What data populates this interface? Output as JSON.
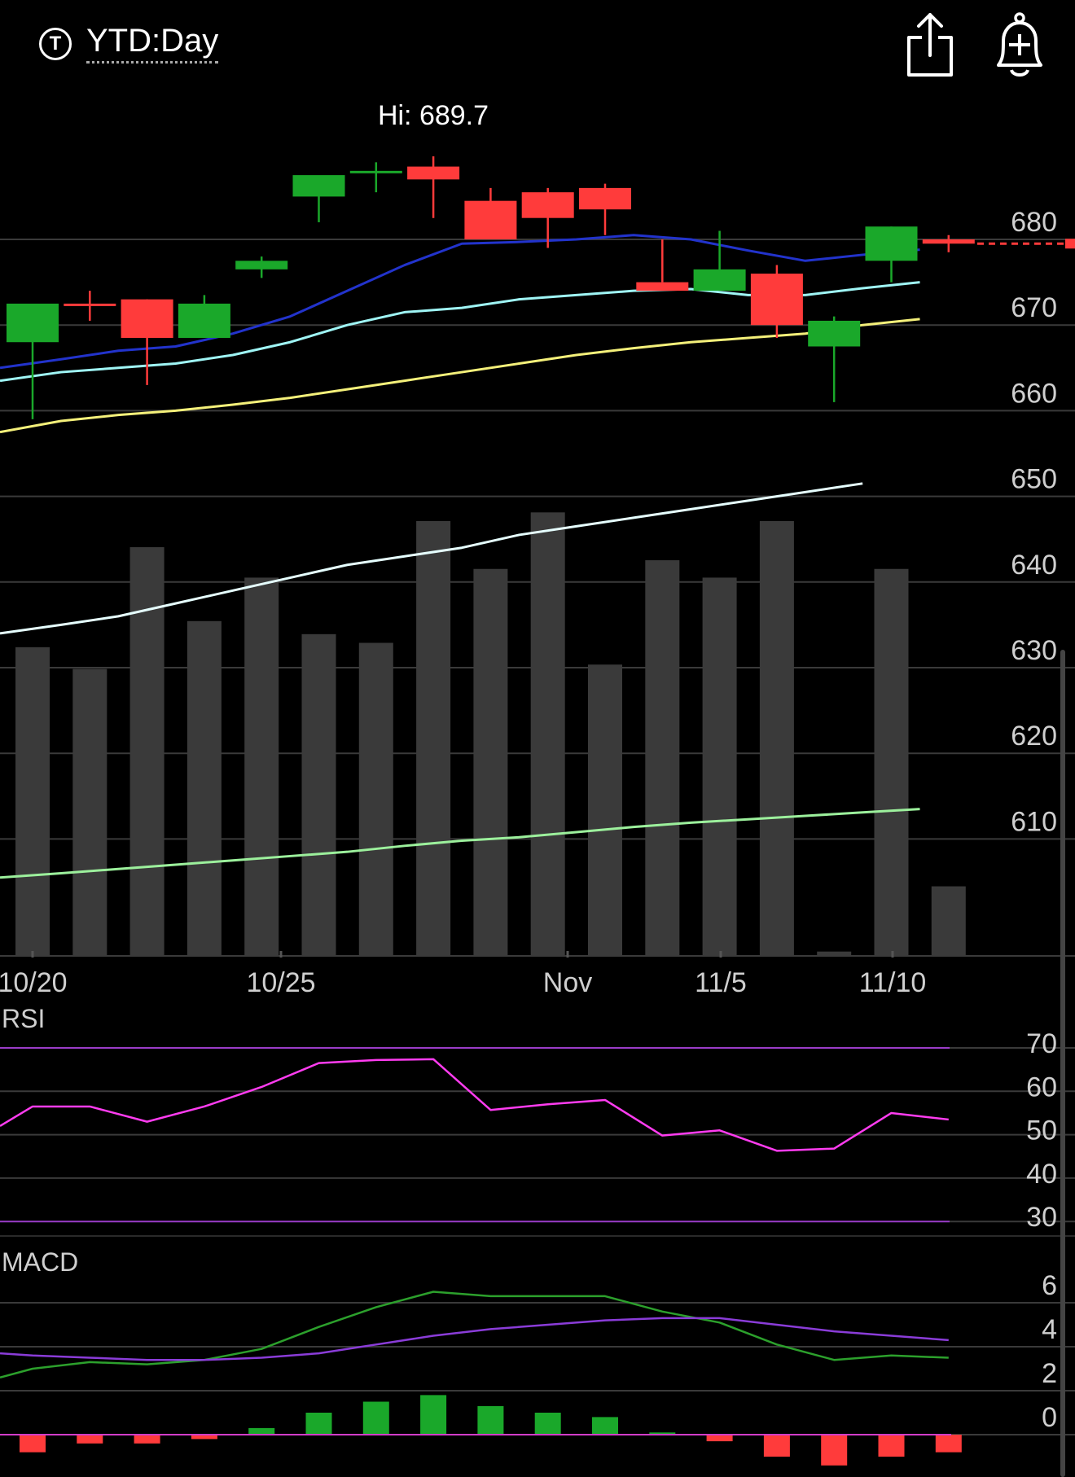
{
  "header": {
    "t_icon_letter": "T",
    "title": "YTD:Day",
    "share_icon": "share-icon",
    "alert_icon": "bell-plus-icon"
  },
  "colors": {
    "up": "#1aa82a",
    "down": "#ff3b3b",
    "ma_blue": "#2233cc",
    "ma_cyan": "#9ff5f5",
    "ma_yellow": "#f4f07a",
    "vol_white": "#e6ffff",
    "vol_green": "#9cf09c",
    "rsi": "#ff3cf0",
    "rsi_bounds": "#9a3cc8",
    "macd": "#2ca02c",
    "signal": "#8a3cd8",
    "hist_up": "#1aa82a",
    "hist_down": "#ff3b3b"
  },
  "chart_data": [
    {
      "type": "candlestick",
      "hi_label": "Hi: 689.7",
      "y_ticks": [
        "680",
        "670",
        "660",
        "650",
        "640",
        "630",
        "620",
        "610"
      ],
      "x_labels": [
        "10/20",
        "10/25",
        "Nov",
        "11/5",
        "11/10"
      ],
      "last_price_line": 679.5,
      "candles": [
        {
          "o": 668,
          "h": 671,
          "l": 659,
          "c": 672.5,
          "dir": "up"
        },
        {
          "o": 672.5,
          "h": 674,
          "l": 670.5,
          "c": 672.5,
          "dir": "down"
        },
        {
          "o": 673,
          "h": 673,
          "l": 663,
          "c": 668.5,
          "dir": "down"
        },
        {
          "o": 668.5,
          "h": 673.5,
          "l": 668.5,
          "c": 672.5,
          "dir": "up"
        },
        {
          "o": 676.5,
          "h": 678,
          "l": 675.5,
          "c": 677.5,
          "dir": "up"
        },
        {
          "o": 685,
          "h": 685.5,
          "l": 682,
          "c": 687.5,
          "dir": "up"
        },
        {
          "o": 688,
          "h": 689,
          "l": 685.5,
          "c": 688,
          "dir": "up"
        },
        {
          "o": 688.5,
          "h": 689.7,
          "l": 682.5,
          "c": 687,
          "dir": "down"
        },
        {
          "o": 684.5,
          "h": 686,
          "l": 680,
          "c": 680,
          "dir": "down"
        },
        {
          "o": 685.5,
          "h": 686,
          "l": 679,
          "c": 682.5,
          "dir": "down"
        },
        {
          "o": 686,
          "h": 686.5,
          "l": 680.5,
          "c": 683.5,
          "dir": "down"
        },
        {
          "o": 674,
          "h": 680,
          "l": 675,
          "c": 675,
          "dir": "down"
        },
        {
          "o": 674,
          "h": 681,
          "l": 674,
          "c": 676.5,
          "dir": "up"
        },
        {
          "o": 676,
          "h": 677,
          "l": 668.5,
          "c": 670,
          "dir": "down"
        },
        {
          "o": 667.5,
          "h": 671,
          "l": 661,
          "c": 670.5,
          "dir": "up"
        },
        {
          "o": 677.5,
          "h": 681.5,
          "l": 675,
          "c": 681.5,
          "dir": "up"
        },
        {
          "o": 680,
          "h": 680.5,
          "l": 678.5,
          "c": 679.5,
          "dir": "down"
        }
      ],
      "ma_blue": [
        665,
        666,
        667,
        667.5,
        669,
        671,
        674,
        677,
        679.5,
        679.7,
        680,
        680.5,
        680,
        678.7,
        677.5,
        678.2,
        678.8
      ],
      "ma_cyan": [
        663.5,
        664.5,
        665,
        665.5,
        666.5,
        668,
        670,
        671.5,
        672,
        673,
        673.5,
        674,
        674.2,
        673.5,
        673.5,
        674.3,
        675
      ],
      "ma_yellow": [
        657.5,
        658.8,
        659.5,
        660,
        660.7,
        661.5,
        662.5,
        663.5,
        664.5,
        665.5,
        666.5,
        667.3,
        668,
        668.5,
        669,
        670,
        670.7
      ],
      "volume_line_white": [
        634,
        635,
        636,
        637.5,
        639,
        640.5,
        642,
        643,
        644,
        645.5,
        646.5,
        647.5,
        648.5,
        649.5,
        650.5,
        651.5
      ],
      "volume_line_green": [
        605.5,
        606,
        606.5,
        607,
        607.5,
        608,
        608.5,
        609.2,
        609.8,
        610.2,
        610.8,
        611.4,
        611.9,
        612.3,
        612.7,
        613.1,
        613.5
      ],
      "volume": [
        0.71,
        0.66,
        0.94,
        0.77,
        0.87,
        0.74,
        0.72,
        1.0,
        0.89,
        1.02,
        0.67,
        0.91,
        0.87,
        1.0,
        0.01,
        0.89,
        0.16
      ]
    },
    {
      "type": "line",
      "label": "RSI",
      "y_ticks": [
        "70",
        "60",
        "50",
        "40",
        "30"
      ],
      "upper_bound": 70,
      "lower_bound": 30,
      "values": [
        52,
        56.5,
        56.5,
        53,
        56.5,
        61,
        66.5,
        67.2,
        67.4,
        55.7,
        57,
        58,
        49.8,
        51,
        46.3,
        46.8,
        55,
        53.5
      ]
    },
    {
      "type": "line",
      "label": "MACD",
      "y_ticks": [
        "6",
        "4",
        "2",
        "0"
      ],
      "macd": [
        2.6,
        3.0,
        3.3,
        3.2,
        3.4,
        3.9,
        4.9,
        5.8,
        6.5,
        6.3,
        6.3,
        6.3,
        5.6,
        5.1,
        4.1,
        3.4,
        3.6,
        3.5
      ],
      "signal": [
        3.7,
        3.6,
        3.5,
        3.4,
        3.4,
        3.5,
        3.7,
        4.1,
        4.5,
        4.8,
        5.0,
        5.2,
        5.3,
        5.3,
        5.0,
        4.7,
        4.5,
        4.3
      ],
      "histogram": [
        -0.8,
        -0.4,
        -0.4,
        -0.2,
        0.3,
        1.0,
        1.5,
        1.8,
        1.3,
        1.0,
        0.8,
        0.1,
        -0.3,
        -1.0,
        -1.4,
        -1.0,
        -0.8
      ]
    }
  ]
}
